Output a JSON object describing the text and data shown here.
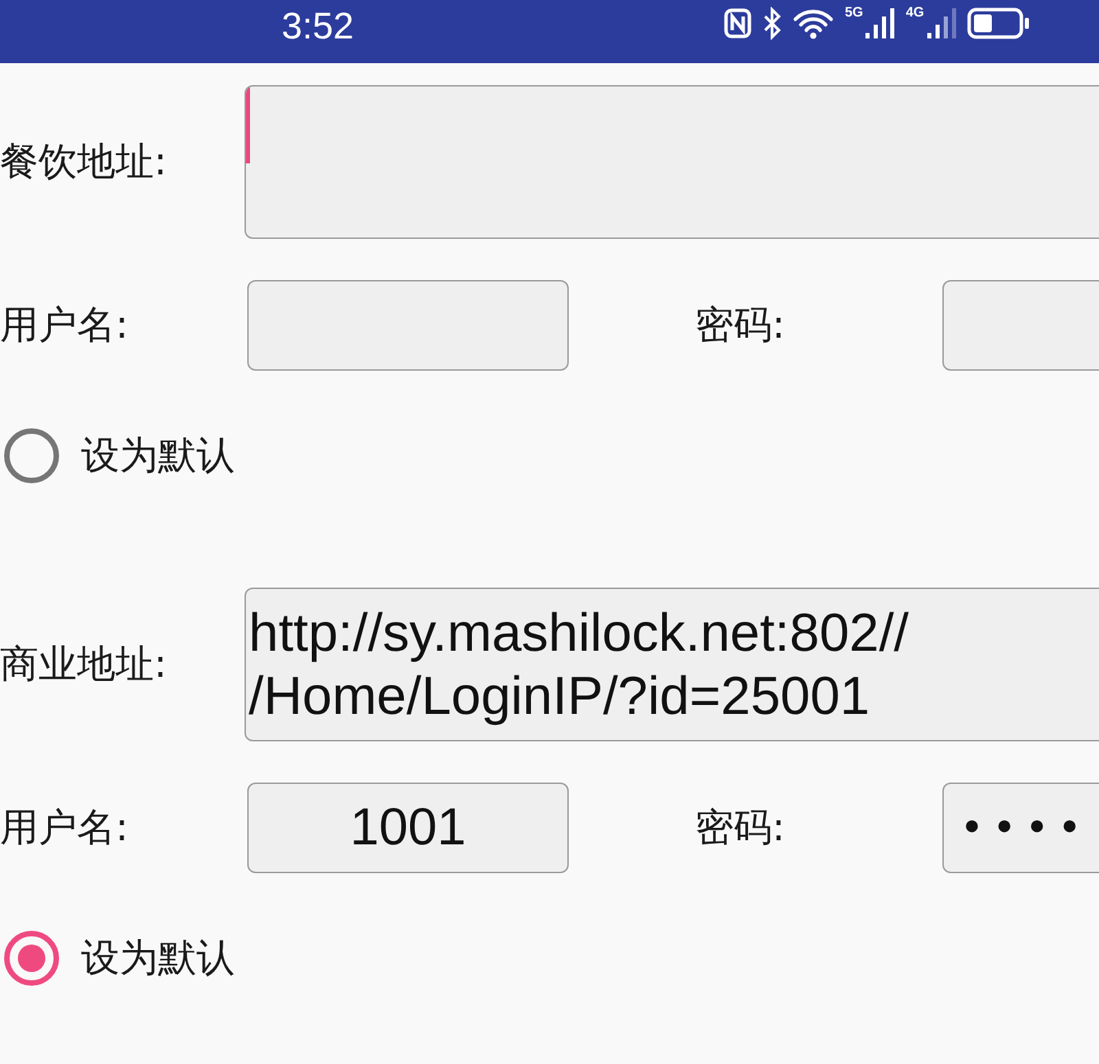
{
  "status_bar": {
    "time": "3:52",
    "network_labels": [
      "5G",
      "4G"
    ]
  },
  "sections": [
    {
      "address_label": "餐饮地址:",
      "address": {
        "focused": true
      },
      "username_label": "用户名:",
      "password_label": "密码:",
      "default_option": {
        "label": "设为默认",
        "selected": false
      }
    },
    {
      "address_label": "商业地址:",
      "address": {
        "value": "http://sy.mashilock.net:802//\n/Home/LoginIP/?id=25001",
        "focused": false
      },
      "username_label": "用户名:",
      "username": {
        "value": "1001"
      },
      "password_label": "密码:",
      "password": {
        "value": "••••"
      },
      "default_option": {
        "label": "设为默认",
        "selected": true
      }
    }
  ]
}
